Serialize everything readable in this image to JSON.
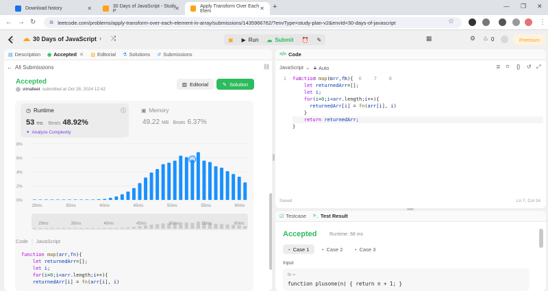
{
  "browser": {
    "tabs": [
      {
        "label": "Download history",
        "active": false
      },
      {
        "label": "30 Days of JavaScript - Study P",
        "active": false
      },
      {
        "label": "Apply Transform Over Each Elem",
        "active": true
      }
    ],
    "new_tab": "+",
    "url": "leetcode.com/problems/apply-transform-over-each-element-in-array/submissions/1435966762/?envType=study-plan-v2&envId=30-days-of-javascript"
  },
  "header": {
    "study_plan": "30 Days of JavaScript",
    "run_label": "Run",
    "submit_label": "Submit",
    "fire_count": "0",
    "premium_label": "Premium"
  },
  "left": {
    "tabs": [
      {
        "label": "Description",
        "icon": "description-icon"
      },
      {
        "label": "Accepted",
        "icon": "accepted-icon"
      },
      {
        "label": "Editorial",
        "icon": "editorial-icon"
      },
      {
        "label": "Solutions",
        "icon": "solutions-icon"
      },
      {
        "label": "Submissions",
        "icon": "submissions-icon"
      }
    ],
    "back_label": "All Submissions",
    "status": "Accepted",
    "user": "vimalleet",
    "submitted_text": "submitted at Oct 28, 2024 12:42",
    "editorial_btn": "Editorial",
    "solution_btn": "Solution",
    "runtime": {
      "label": "Runtime",
      "value": "53",
      "unit": "ms",
      "beats_label": "Beats",
      "beats_value": "48.92%",
      "analyze": "Analyze Complexity"
    },
    "memory": {
      "label": "Memory",
      "value": "49.22",
      "unit": "MB",
      "beats_label": "Beats",
      "beats_value": "6.37%"
    },
    "code_header": {
      "label": "Code",
      "lang": "JavaScript"
    },
    "code_preview": [
      "function map(arr,fn){",
      "    let returnedArr=[];",
      "    let i;",
      "    for(i=0;i<arr.length;i++){",
      "    returnedArr[i] = fn(arr[i], i)"
    ]
  },
  "chart_data": {
    "type": "bar",
    "y_ticks": [
      "8%",
      "6%",
      "4%",
      "2%",
      "0%"
    ],
    "x_ticks": [
      "29ms",
      "35ms",
      "40ms",
      "45ms",
      "50ms",
      "55ms",
      "60ms"
    ],
    "slider_ticks": [
      "29ms",
      "35ms",
      "40ms",
      "45ms",
      "50ms",
      "55ms",
      "60ms"
    ],
    "ylim": [
      0,
      8
    ],
    "values": [
      0.05,
      0.05,
      0.05,
      0.05,
      0.05,
      0.05,
      0.05,
      0.05,
      0.05,
      0.05,
      0.05,
      0.1,
      0.15,
      0.3,
      0.5,
      0.8,
      1.2,
      1.7,
      2.4,
      3.2,
      3.9,
      4.4,
      5.1,
      5.3,
      5.6,
      6.3,
      6.1,
      5.7,
      6.8,
      5.6,
      5.4,
      4.8,
      4.6,
      4.1,
      3.7,
      3.3,
      2.5
    ],
    "highlight_index": 27,
    "bar_color": "#1a90ff",
    "grid": true
  },
  "editor": {
    "panel_title": "Code",
    "lang": "JavaScript",
    "mode": "Auto",
    "line_numbers": [
      "1",
      "2",
      "3",
      "4",
      "5",
      "6",
      "7",
      "8"
    ],
    "saved": "Saved",
    "cursor": "Ln 7, Col 24"
  },
  "bottom": {
    "tabs": [
      {
        "label": "Testcase"
      },
      {
        "label": "Test Result"
      }
    ],
    "status": "Accepted",
    "runtime_text": "Runtime: 68 ms",
    "cases": [
      "Case 1",
      "Case 2",
      "Case 3"
    ],
    "input_label": "Input",
    "param_name": "fn =",
    "param_value": "function plusone(n) { return n + 1; }"
  },
  "colors": {
    "accent_green": "#2cbb5d",
    "brand_orange": "#ffa116",
    "bar_blue": "#1a90ff"
  }
}
